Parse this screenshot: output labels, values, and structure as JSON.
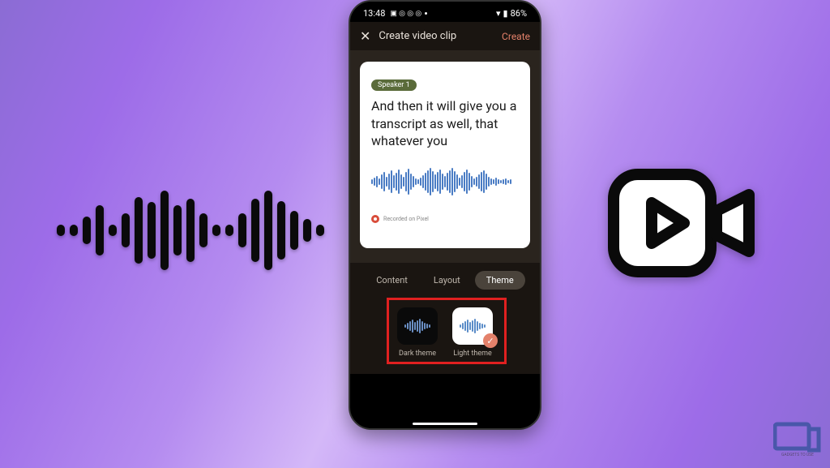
{
  "status": {
    "time": "13:48",
    "battery": "86%"
  },
  "header": {
    "title": "Create video clip",
    "create": "Create"
  },
  "preview": {
    "speaker": "Speaker 1",
    "transcript": "And then it will give you a transcript as well, that whatever you",
    "recorded": "Recorded on Pixel"
  },
  "tabs": {
    "content": "Content",
    "layout": "Layout",
    "theme": "Theme"
  },
  "themes": {
    "dark": "Dark theme",
    "light": "Light theme"
  },
  "logo": {
    "text": "GADGETS TO USE"
  }
}
